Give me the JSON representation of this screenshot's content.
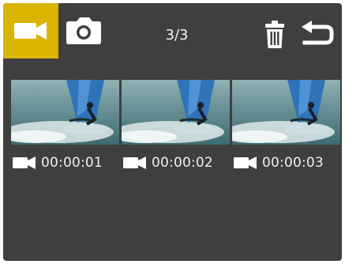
{
  "topbar": {
    "video_mode_icon": "video-camera-icon",
    "photo_mode_icon": "camera-icon",
    "counter": "3/3",
    "delete_icon": "trash-icon",
    "back_icon": "return-arrow-icon",
    "accent_color": "#d9b400"
  },
  "files": [
    {
      "type_icon": "video-camera-icon",
      "duration": "00:00:01"
    },
    {
      "type_icon": "video-camera-icon",
      "duration": "00:00:02"
    },
    {
      "type_icon": "video-camera-icon",
      "duration": "00:00:03"
    }
  ]
}
